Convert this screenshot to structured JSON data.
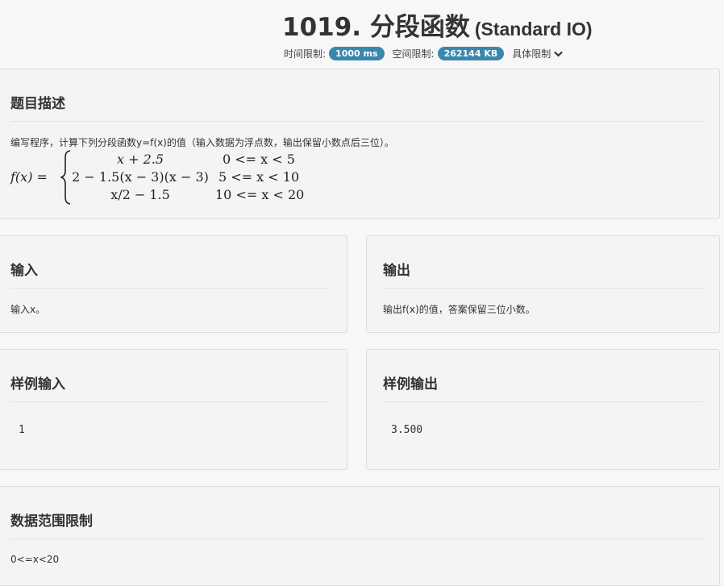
{
  "header": {
    "title": "1019. 分段函数",
    "io_type": "(Standard IO)",
    "time_label": "时间限制:",
    "time_value": "1000 ms",
    "space_label": "空间限制:",
    "space_value": "262144 KB",
    "detail_label": "具体限制",
    "badge_color": "#3a87ad"
  },
  "description": {
    "heading": "题目描述",
    "text": "编写程序，计算下列分段函数y=f(x)的值（输入数据为浮点数，输出保留小数点后三位）。",
    "formula": {
      "lhs": "f(x) =",
      "cases": [
        {
          "expr": "x + 2.5",
          "cond": "0 <= x < 5"
        },
        {
          "expr": "2 − 1.5(x − 3)(x − 3)",
          "cond": "5 <= x < 10"
        },
        {
          "expr": "x/2 − 1.5",
          "cond": "10 <= x < 20"
        }
      ]
    }
  },
  "input": {
    "heading": "输入",
    "text": "输入x。"
  },
  "output": {
    "heading": "输出",
    "text": "输出f(x)的值，答案保留三位小数。"
  },
  "sample_input": {
    "heading": "样例输入",
    "text": "1"
  },
  "sample_output": {
    "heading": "样例输出",
    "text": "3.500"
  },
  "constraints": {
    "heading": "数据范围限制",
    "text": "0<=x<20"
  }
}
